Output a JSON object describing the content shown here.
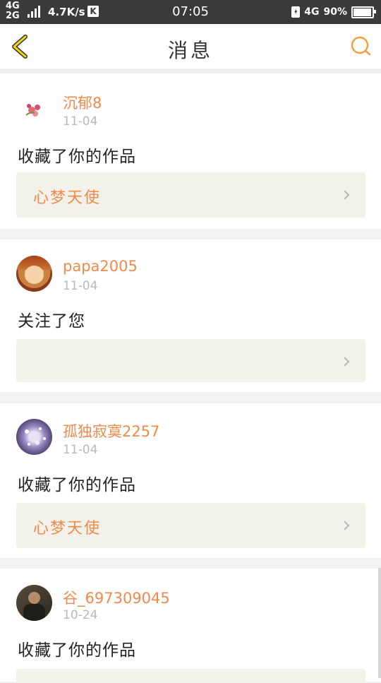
{
  "status": {
    "net_top": "4G",
    "net_bottom": "2G",
    "speed": "4.7K/s",
    "k_badge": "K",
    "time": "07:05",
    "net_right": "4G",
    "battery": "90%"
  },
  "nav": {
    "title": "消息",
    "back_icon": "chevron-left-icon",
    "search_icon": "search-icon",
    "accent": "#f0a040"
  },
  "messages": [
    {
      "username": "沉郁8",
      "date": "11-04",
      "action": "收藏了你的作品",
      "work_title": "心梦天使",
      "avatar": "flower"
    },
    {
      "username": "papa2005",
      "date": "11-04",
      "action": "关注了您",
      "work_title": "",
      "avatar": "photo-girl"
    },
    {
      "username": "孤独寂寞2257",
      "date": "11-04",
      "action": "收藏了你的作品",
      "work_title": "心梦天使",
      "avatar": "sparkle"
    },
    {
      "username": "谷_697309045",
      "date": "10-24",
      "action": "收藏了你的作品",
      "work_title": "",
      "avatar": "photo-man"
    }
  ]
}
